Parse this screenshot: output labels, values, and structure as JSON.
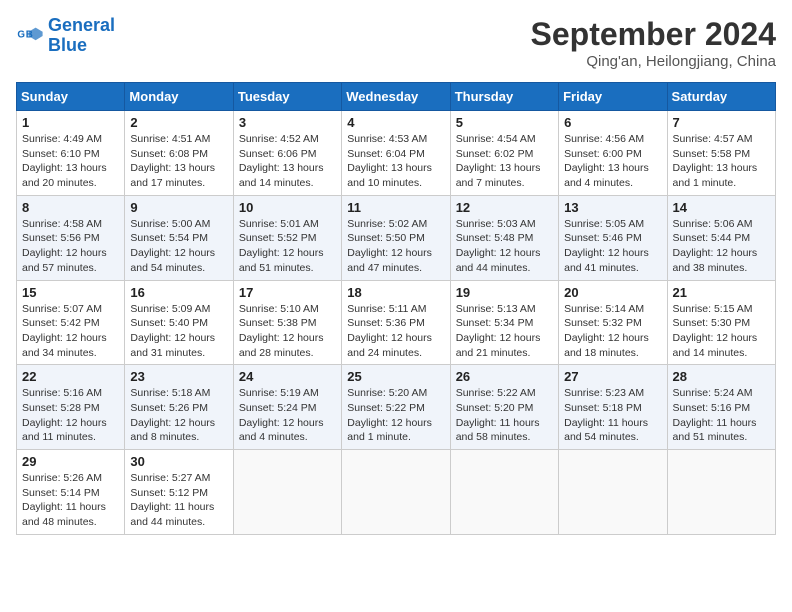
{
  "logo": {
    "line1": "General",
    "line2": "Blue"
  },
  "title": "September 2024",
  "subtitle": "Qing'an, Heilongjiang, China",
  "days_of_week": [
    "Sunday",
    "Monday",
    "Tuesday",
    "Wednesday",
    "Thursday",
    "Friday",
    "Saturday"
  ],
  "weeks": [
    [
      {
        "day": 1,
        "sunrise": "4:49 AM",
        "sunset": "6:10 PM",
        "daylight": "13 hours and 20 minutes."
      },
      {
        "day": 2,
        "sunrise": "4:51 AM",
        "sunset": "6:08 PM",
        "daylight": "13 hours and 17 minutes."
      },
      {
        "day": 3,
        "sunrise": "4:52 AM",
        "sunset": "6:06 PM",
        "daylight": "13 hours and 14 minutes."
      },
      {
        "day": 4,
        "sunrise": "4:53 AM",
        "sunset": "6:04 PM",
        "daylight": "13 hours and 10 minutes."
      },
      {
        "day": 5,
        "sunrise": "4:54 AM",
        "sunset": "6:02 PM",
        "daylight": "13 hours and 7 minutes."
      },
      {
        "day": 6,
        "sunrise": "4:56 AM",
        "sunset": "6:00 PM",
        "daylight": "13 hours and 4 minutes."
      },
      {
        "day": 7,
        "sunrise": "4:57 AM",
        "sunset": "5:58 PM",
        "daylight": "13 hours and 1 minute."
      }
    ],
    [
      {
        "day": 8,
        "sunrise": "4:58 AM",
        "sunset": "5:56 PM",
        "daylight": "12 hours and 57 minutes."
      },
      {
        "day": 9,
        "sunrise": "5:00 AM",
        "sunset": "5:54 PM",
        "daylight": "12 hours and 54 minutes."
      },
      {
        "day": 10,
        "sunrise": "5:01 AM",
        "sunset": "5:52 PM",
        "daylight": "12 hours and 51 minutes."
      },
      {
        "day": 11,
        "sunrise": "5:02 AM",
        "sunset": "5:50 PM",
        "daylight": "12 hours and 47 minutes."
      },
      {
        "day": 12,
        "sunrise": "5:03 AM",
        "sunset": "5:48 PM",
        "daylight": "12 hours and 44 minutes."
      },
      {
        "day": 13,
        "sunrise": "5:05 AM",
        "sunset": "5:46 PM",
        "daylight": "12 hours and 41 minutes."
      },
      {
        "day": 14,
        "sunrise": "5:06 AM",
        "sunset": "5:44 PM",
        "daylight": "12 hours and 38 minutes."
      }
    ],
    [
      {
        "day": 15,
        "sunrise": "5:07 AM",
        "sunset": "5:42 PM",
        "daylight": "12 hours and 34 minutes."
      },
      {
        "day": 16,
        "sunrise": "5:09 AM",
        "sunset": "5:40 PM",
        "daylight": "12 hours and 31 minutes."
      },
      {
        "day": 17,
        "sunrise": "5:10 AM",
        "sunset": "5:38 PM",
        "daylight": "12 hours and 28 minutes."
      },
      {
        "day": 18,
        "sunrise": "5:11 AM",
        "sunset": "5:36 PM",
        "daylight": "12 hours and 24 minutes."
      },
      {
        "day": 19,
        "sunrise": "5:13 AM",
        "sunset": "5:34 PM",
        "daylight": "12 hours and 21 minutes."
      },
      {
        "day": 20,
        "sunrise": "5:14 AM",
        "sunset": "5:32 PM",
        "daylight": "12 hours and 18 minutes."
      },
      {
        "day": 21,
        "sunrise": "5:15 AM",
        "sunset": "5:30 PM",
        "daylight": "12 hours and 14 minutes."
      }
    ],
    [
      {
        "day": 22,
        "sunrise": "5:16 AM",
        "sunset": "5:28 PM",
        "daylight": "12 hours and 11 minutes."
      },
      {
        "day": 23,
        "sunrise": "5:18 AM",
        "sunset": "5:26 PM",
        "daylight": "12 hours and 8 minutes."
      },
      {
        "day": 24,
        "sunrise": "5:19 AM",
        "sunset": "5:24 PM",
        "daylight": "12 hours and 4 minutes."
      },
      {
        "day": 25,
        "sunrise": "5:20 AM",
        "sunset": "5:22 PM",
        "daylight": "12 hours and 1 minute."
      },
      {
        "day": 26,
        "sunrise": "5:22 AM",
        "sunset": "5:20 PM",
        "daylight": "11 hours and 58 minutes."
      },
      {
        "day": 27,
        "sunrise": "5:23 AM",
        "sunset": "5:18 PM",
        "daylight": "11 hours and 54 minutes."
      },
      {
        "day": 28,
        "sunrise": "5:24 AM",
        "sunset": "5:16 PM",
        "daylight": "11 hours and 51 minutes."
      }
    ],
    [
      {
        "day": 29,
        "sunrise": "5:26 AM",
        "sunset": "5:14 PM",
        "daylight": "11 hours and 48 minutes."
      },
      {
        "day": 30,
        "sunrise": "5:27 AM",
        "sunset": "5:12 PM",
        "daylight": "11 hours and 44 minutes."
      },
      null,
      null,
      null,
      null,
      null
    ]
  ]
}
